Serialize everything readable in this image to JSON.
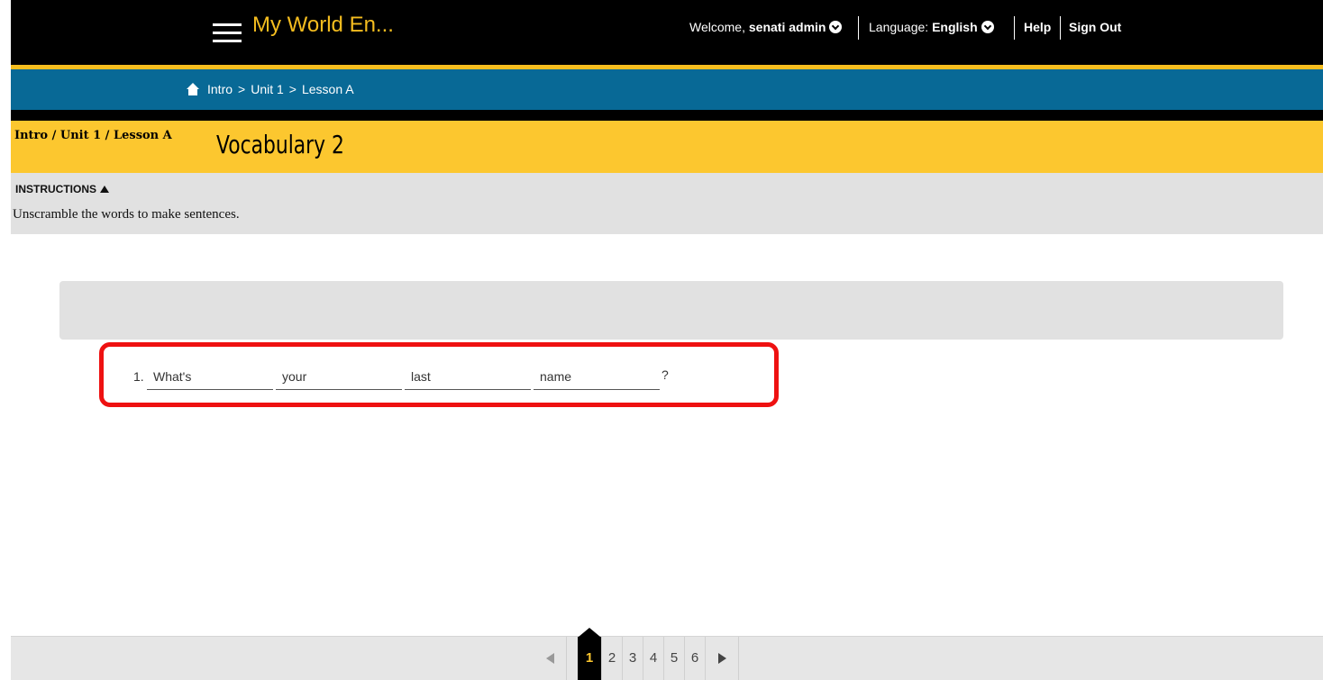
{
  "header": {
    "app_title": "My World En...",
    "welcome_prefix": "Welcome,",
    "user_name": "senati admin",
    "language_prefix": "Language:",
    "language_value": "English",
    "help_label": "Help",
    "signout_label": "Sign Out"
  },
  "breadcrumb": {
    "items": [
      "Intro",
      "Unit 1",
      "Lesson A"
    ],
    "separator": ">"
  },
  "activity": {
    "path_label": "Intro / Unit 1 / Lesson A",
    "title": "Vocabulary 2"
  },
  "instructions": {
    "toggle_label": "INSTRUCTIONS",
    "text": "Unscramble the words to make sentences."
  },
  "question": {
    "number": "1.",
    "words": [
      "What's",
      "your",
      "last",
      "name"
    ],
    "ending": "?"
  },
  "pager": {
    "pages": [
      "1",
      "2",
      "3",
      "4",
      "5",
      "6"
    ],
    "current": "1"
  },
  "colors": {
    "accent_yellow": "#fcc72f",
    "header_black": "#000000",
    "breadcrumb_blue": "#086996",
    "highlight_red": "#ee1111"
  }
}
